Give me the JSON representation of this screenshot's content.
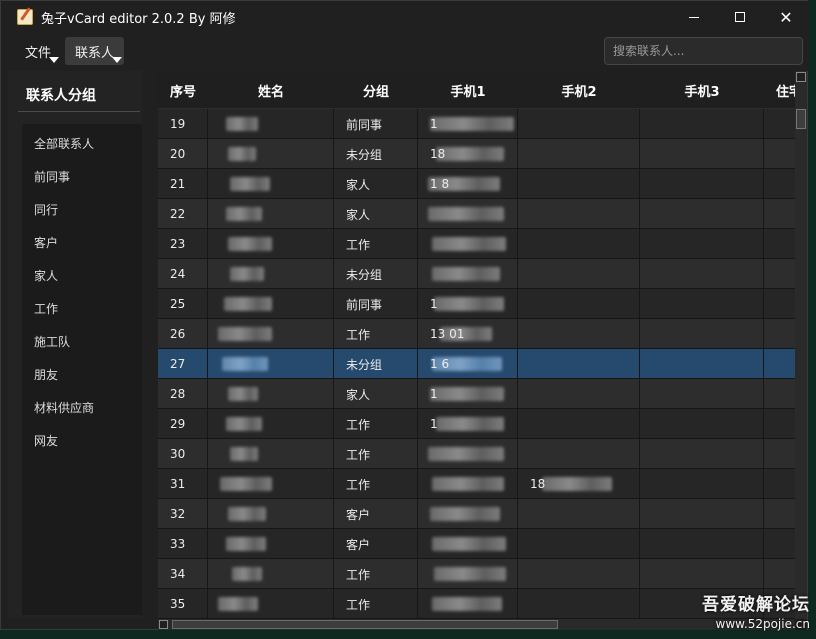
{
  "window": {
    "title": "兔子vCard editor 2.0.2 By 阿修",
    "accent_color": "#26496e"
  },
  "menu": {
    "file_label": "文件",
    "contacts_label": "联系人"
  },
  "search": {
    "placeholder": "搜索联系人..."
  },
  "sidebar": {
    "title": "联系人分组",
    "groups": [
      "全部联系人",
      "前同事",
      "同行",
      "客户",
      "家人",
      "工作",
      "施工队",
      "朋友",
      "材料供应商",
      "网友"
    ]
  },
  "table": {
    "headers": [
      "序号",
      "姓名",
      "分组",
      "手机1",
      "手机2",
      "手机3",
      "住宅"
    ],
    "rows": [
      {
        "no": "19",
        "group": "前同事",
        "phone1": "1",
        "phone2": "",
        "selected": false
      },
      {
        "no": "20",
        "group": "未分组",
        "phone1": "18",
        "phone2": "",
        "selected": false
      },
      {
        "no": "21",
        "group": "家人",
        "phone1": "1        8",
        "phone2": "",
        "selected": false
      },
      {
        "no": "22",
        "group": "家人",
        "phone1": "",
        "phone2": "",
        "selected": false
      },
      {
        "no": "23",
        "group": "工作",
        "phone1": "",
        "phone2": "",
        "selected": false
      },
      {
        "no": "24",
        "group": "未分组",
        "phone1": "",
        "phone2": "",
        "selected": false
      },
      {
        "no": "25",
        "group": "前同事",
        "phone1": "1",
        "phone2": "",
        "selected": false
      },
      {
        "no": "26",
        "group": "工作",
        "phone1": "13        01",
        "phone2": "",
        "selected": false
      },
      {
        "no": "27",
        "group": "未分组",
        "phone1": "1        6",
        "phone2": "",
        "selected": true
      },
      {
        "no": "28",
        "group": "家人",
        "phone1": "1",
        "phone2": "",
        "selected": false
      },
      {
        "no": "29",
        "group": "工作",
        "phone1": "1",
        "phone2": "",
        "selected": false
      },
      {
        "no": "30",
        "group": "工作",
        "phone1": "",
        "phone2": "",
        "selected": false
      },
      {
        "no": "31",
        "group": "工作",
        "phone1": "",
        "phone2": "18",
        "selected": false
      },
      {
        "no": "32",
        "group": "客户",
        "phone1": "",
        "phone2": "",
        "selected": false
      },
      {
        "no": "33",
        "group": "客户",
        "phone1": "",
        "phone2": "",
        "selected": false
      },
      {
        "no": "34",
        "group": "工作",
        "phone1": "",
        "phone2": "",
        "selected": false
      },
      {
        "no": "35",
        "group": "工作",
        "phone1": "",
        "phone2": "",
        "selected": false
      }
    ]
  },
  "watermark": {
    "line1": "吾爱破解论坛",
    "line2": "www.52pojie.cn"
  }
}
